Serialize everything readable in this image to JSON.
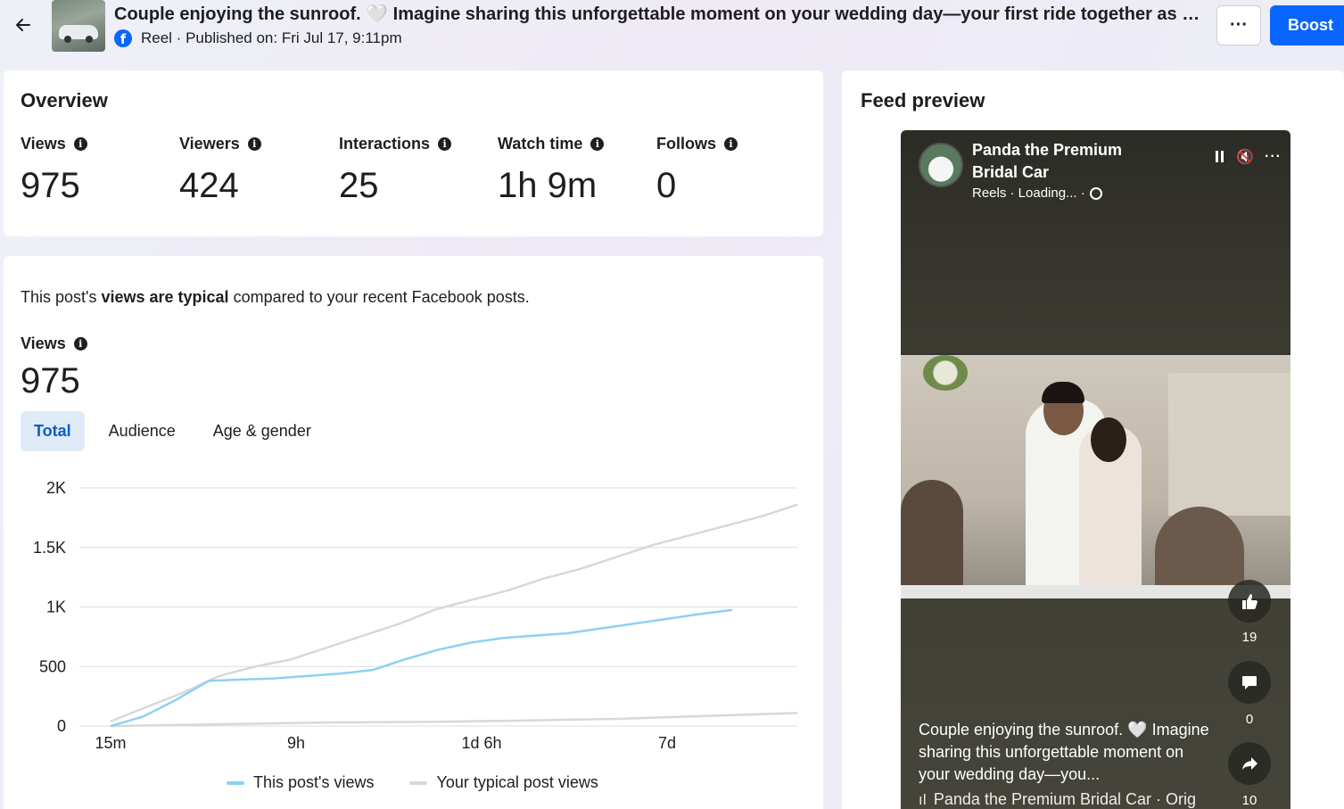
{
  "header": {
    "title": "Couple enjoying the sunroof. 🤍 Imagine sharing this unforgettable moment on your wedding day—your first ride together as husb...",
    "subline": "Reel · Published on: Fri Jul 17, 9:11pm",
    "more_label": "···",
    "boost_label": "Boost"
  },
  "overview": {
    "title": "Overview",
    "metrics": [
      {
        "label": "Views",
        "value": "975"
      },
      {
        "label": "Viewers",
        "value": "424"
      },
      {
        "label": "Interactions",
        "value": "25"
      },
      {
        "label": "Watch time",
        "value": "1h 9m"
      },
      {
        "label": "Follows",
        "value": "0"
      }
    ]
  },
  "views_section": {
    "typical_prefix": "This post's ",
    "typical_bold": "views are typical",
    "typical_suffix": " compared to your recent Facebook posts.",
    "label": "Views",
    "value": "975",
    "tabs": [
      "Total",
      "Audience",
      "Age & gender"
    ],
    "legend": [
      "This post's views",
      "Your typical post views"
    ]
  },
  "chart_data": {
    "type": "line",
    "x_ticks": [
      "15m",
      "9h",
      "1d 6h",
      "7d"
    ],
    "y_ticks": [
      "0",
      "500",
      "1K",
      "1.5K",
      "2K"
    ],
    "ylim": [
      0,
      2000
    ],
    "series": [
      {
        "name": "This post's views",
        "color": "#8fd0f2",
        "values": [
          0,
          80,
          220,
          380,
          390,
          400,
          420,
          440,
          470,
          560,
          640,
          700,
          740,
          760,
          780,
          820,
          860,
          900,
          940,
          975
        ]
      },
      {
        "name": "Your typical post views",
        "color": "#d6d8db",
        "values": [
          40,
          160,
          280,
          420,
          500,
          560,
          660,
          760,
          860,
          980,
          1060,
          1140,
          1240,
          1320,
          1420,
          1520,
          1600,
          1680,
          1760,
          1860
        ],
        "lower": [
          0,
          5,
          10,
          15,
          20,
          25,
          30,
          32,
          34,
          36,
          40,
          44,
          50,
          55,
          60,
          70,
          80,
          90,
          100,
          110
        ]
      }
    ],
    "grid": true,
    "legend_position": "bottom-center"
  },
  "feed": {
    "title": "Feed preview",
    "page_name": "Panda the Premium Bridal Car",
    "sub": "Reels · Loading... ·",
    "likes": "19",
    "comments": "0",
    "shares": "10",
    "caption": "Couple enjoying the sunroof. 🤍 Imagine sharing this unforgettable moment on your wedding day—you...",
    "music": "Panda the Premium Bridal Car · Orig"
  }
}
